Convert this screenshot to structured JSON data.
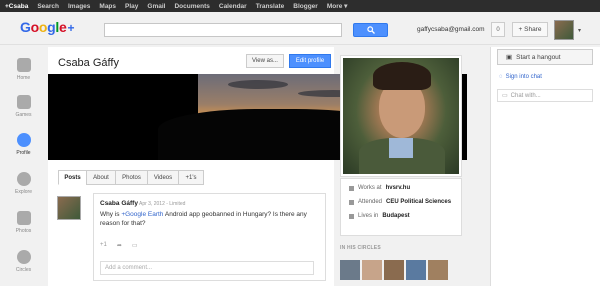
{
  "topbar": {
    "items": [
      "+Csaba",
      "Search",
      "Images",
      "Maps",
      "Play",
      "Gmail",
      "Documents",
      "Calendar",
      "Translate",
      "Blogger",
      "More ▾"
    ]
  },
  "header": {
    "email": "gaffycsaba@gmail.com",
    "count": "0",
    "share_label": "+ Share"
  },
  "leftnav": {
    "items": [
      "Home",
      "Games",
      "Profile",
      "Explore",
      "Photos",
      "Circles"
    ]
  },
  "profile": {
    "name": "Csaba Gáffy",
    "view_as": "View as...",
    "edit_profile": "Edit profile"
  },
  "tabs": [
    "Posts",
    "About",
    "Photos",
    "Videos",
    "+1's"
  ],
  "post": {
    "author": "Csaba Gáffy",
    "meta": "Apr 3, 2012 - Limited",
    "text_before": "Why is ",
    "link": "+Google Earth",
    "text_after": " Android app geobanned in Hungary? Is there any reason for that?",
    "plus_one": "+1",
    "comment_placeholder": "Add a comment..."
  },
  "info": {
    "works_prefix": "Works at",
    "works": "hvsrv.hu",
    "attended_prefix": "Attended",
    "attended": "CEU Political Sciences",
    "lives_prefix": "Lives in",
    "lives": "Budapest"
  },
  "circles": {
    "label": "IN HIS CIRCLES"
  },
  "right": {
    "hangout": "Start a hangout",
    "signin": "Sign into chat",
    "chat_with": "Chat with..."
  },
  "colors": {
    "accent": "#4d90fe",
    "topbar": "#2d2d2d",
    "link": "#3366cc"
  }
}
